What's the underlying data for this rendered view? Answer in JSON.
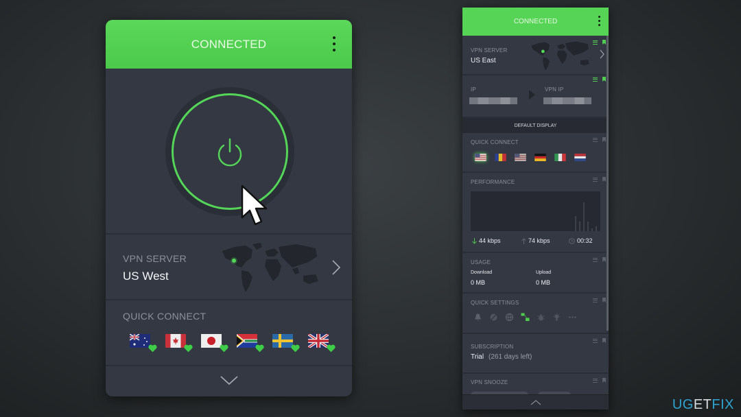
{
  "main_panel": {
    "status_title": "CONNECTED",
    "menu_icon": "kebab-menu-icon",
    "power_button_icon": "power-icon",
    "vpn_server": {
      "label": "VPN SERVER",
      "value": "US West"
    },
    "quick_connect": {
      "label": "QUICK CONNECT",
      "flags": [
        {
          "country": "Australia",
          "favorite": true
        },
        {
          "country": "Canada",
          "favorite": true
        },
        {
          "country": "Japan",
          "favorite": true
        },
        {
          "country": "South Africa",
          "favorite": true
        },
        {
          "country": "Sweden",
          "favorite": true
        },
        {
          "country": "United Kingdom",
          "favorite": true
        }
      ]
    },
    "expand_icon": "chevron-down-icon"
  },
  "side_panel": {
    "status_title": "CONNECTED",
    "vpn_server": {
      "label": "VPN SERVER",
      "value": "US East"
    },
    "ip": {
      "label": "IP",
      "vpn_label": "VPN IP"
    },
    "default_display_label": "DEFAULT DISPLAY",
    "quick_connect": {
      "label": "QUICK CONNECT",
      "flags": [
        "United States",
        "Romania",
        "United States",
        "Germany",
        "Italy",
        "Netherlands"
      ]
    },
    "performance": {
      "label": "PERFORMANCE",
      "download": "44 kbps",
      "upload": "74 kbps",
      "duration": "00:32"
    },
    "usage": {
      "label": "USAGE",
      "download_label": "Download",
      "download_value": "0 MB",
      "upload_label": "Upload",
      "upload_value": "0 MB"
    },
    "quick_settings": {
      "label": "QUICK SETTINGS",
      "icons": [
        "bell-icon",
        "block-icon",
        "globe-icon",
        "split-tunnel-icon",
        "bug-icon",
        "bulb-icon",
        "more-icon"
      ]
    },
    "subscription": {
      "label": "SUBSCRIPTION",
      "plan": "Trial",
      "remaining": "(261 days left)"
    },
    "vpn_snooze": {
      "label": "VPN SNOOZE"
    }
  },
  "watermark": {
    "part1": "UG",
    "part2": "ET",
    "part3": "FIX"
  },
  "colors": {
    "accent_green": "#55d659",
    "panel_bg": "#333843"
  }
}
